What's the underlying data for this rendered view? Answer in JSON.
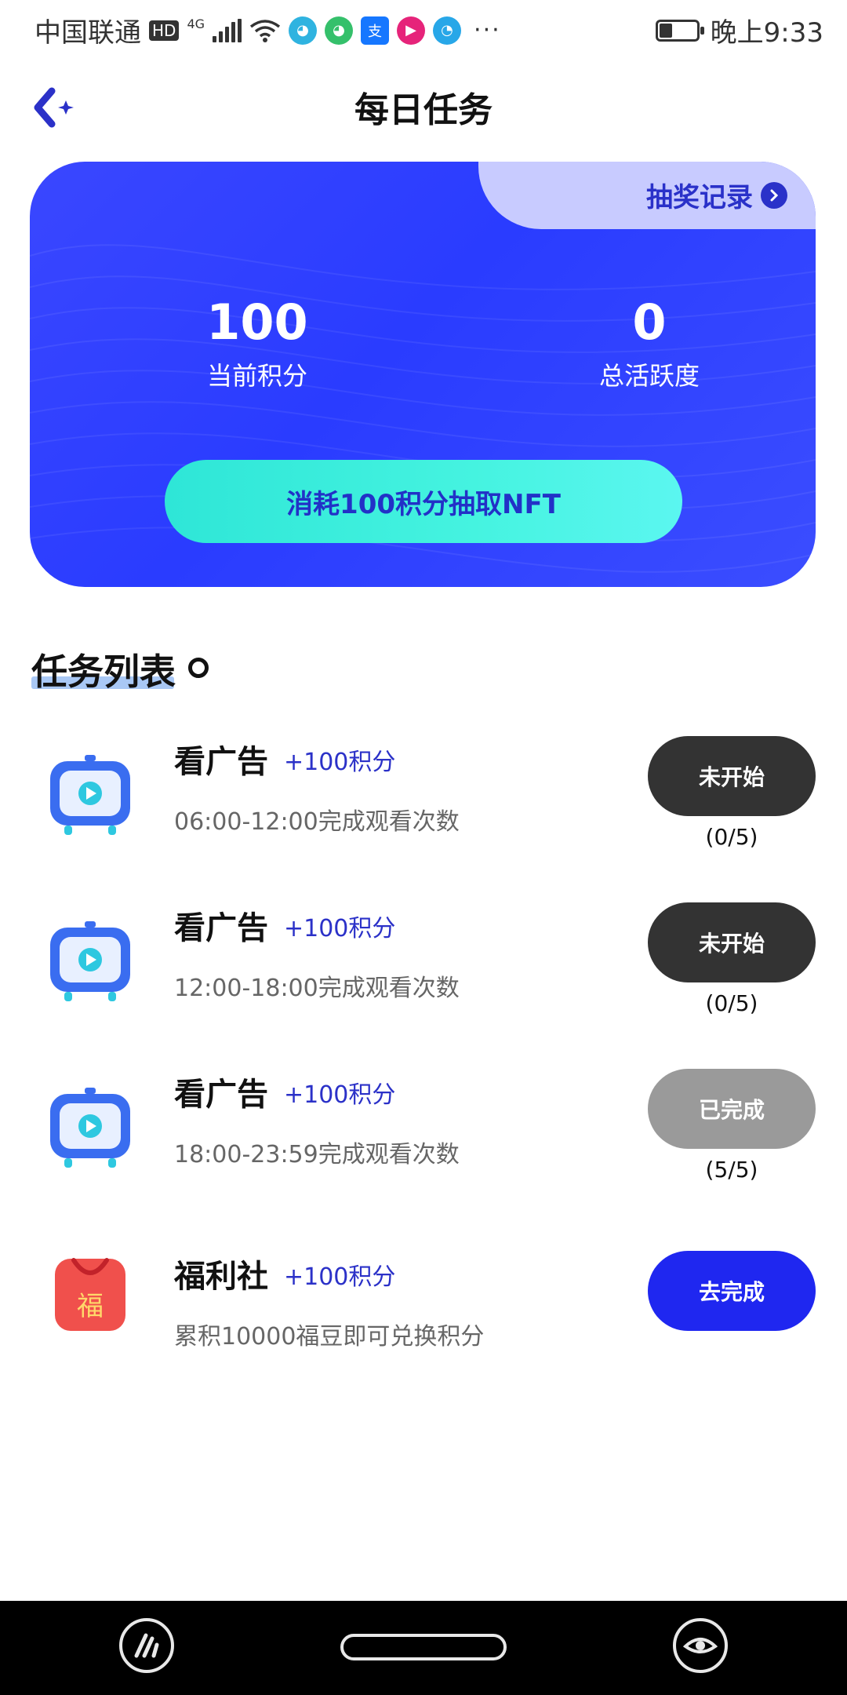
{
  "status_bar": {
    "carrier": "中国联通",
    "hd": "HD",
    "net_type": "4G",
    "apps": [
      {
        "icon": "cloud-app-icon",
        "glyph": "◕",
        "color": "#2fb3e0"
      },
      {
        "icon": "cloud-app-icon",
        "glyph": "◕",
        "color": "#35c06b"
      },
      {
        "icon": "alipay-icon",
        "glyph": "支",
        "color": "#1677ff"
      },
      {
        "icon": "youku-icon",
        "glyph": "▶",
        "color": "#e6247a"
      },
      {
        "icon": "browser-icon",
        "glyph": "◔",
        "color": "#28a7e8"
      }
    ],
    "more": "···",
    "battery_level": 0.35,
    "time": "晚上9:33"
  },
  "header": {
    "title": "每日任务"
  },
  "score_card": {
    "record_link": "抽奖记录",
    "points_value": "100",
    "points_label": "当前积分",
    "activity_value": "0",
    "activity_label": "总活跃度",
    "draw_button": "消耗100积分抽取NFT"
  },
  "tasks_section": {
    "title": "任务列表"
  },
  "tasks": [
    {
      "icon": "tv-play-icon",
      "name": "看广告",
      "reward": "+100积分",
      "desc": "06:00-12:00完成观看次数",
      "button": "未开始",
      "progress": "(0/5)"
    },
    {
      "icon": "tv-play-icon",
      "name": "看广告",
      "reward": "+100积分",
      "desc": "12:00-18:00完成观看次数",
      "button": "未开始",
      "progress": "(0/5)"
    },
    {
      "icon": "tv-play-icon",
      "name": "看广告",
      "reward": "+100积分",
      "desc": "18:00-23:59完成观看次数",
      "button": "已完成",
      "progress": "(5/5)"
    },
    {
      "icon": "fu-bag-icon",
      "glyph": "福",
      "name": "福利社",
      "reward": "+100积分",
      "desc": "累积10000福豆即可兑换积分",
      "button": "去完成",
      "progress": ""
    }
  ],
  "colors": {
    "accent_blue": "#2a3cff",
    "cta_cyan": "#45f3e0",
    "link_blue": "#2b31c8",
    "button_dark": "#333333",
    "button_done": "#9a9a9a",
    "button_go": "#1f27f0"
  }
}
